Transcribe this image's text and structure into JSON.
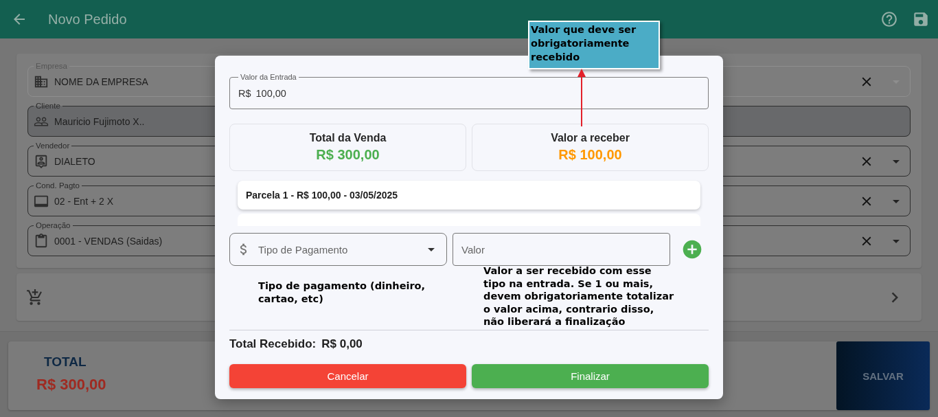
{
  "app_bar": {
    "title": "Novo Pedido"
  },
  "form": {
    "fields": [
      {
        "kind": "company",
        "label": "Empresa",
        "value": "NOME DA EMPRESA",
        "disabled": true,
        "highlighted": false,
        "clearable": true,
        "dropdown": true
      },
      {
        "kind": "client",
        "label": "Cliente",
        "value": "Mauricio Fujimoto X..",
        "disabled": false,
        "highlighted": true,
        "clearable": false,
        "dropdown": false
      },
      {
        "kind": "seller",
        "label": "Vendedor",
        "value": "DIALETO",
        "disabled": false,
        "highlighted": false,
        "clearable": true,
        "dropdown": true
      },
      {
        "kind": "payment",
        "label": "Cond. Pagto",
        "value": "02 - Ent + 2 X",
        "disabled": false,
        "highlighted": false,
        "clearable": true,
        "dropdown": true
      },
      {
        "kind": "operation",
        "label": "Operação",
        "value": "0001 - VENDAS (Saidas)",
        "disabled": false,
        "highlighted": false,
        "clearable": true,
        "dropdown": true
      }
    ]
  },
  "footer": {
    "total_label": "TOTAL",
    "total_value": "R$ 300,00",
    "save_label": "SALVAR"
  },
  "modal": {
    "entry_field": {
      "label": "Valor da Entrada",
      "prefix": "R$",
      "value": "100,00"
    },
    "summary": [
      {
        "label": "Total da Venda",
        "value": "R$ 300,00",
        "color": "#4caf50"
      },
      {
        "label": "Valor a receber",
        "value": "R$ 100,00",
        "color": "#ff9800"
      }
    ],
    "installments": [
      {
        "text": "Parcela 1 - R$ 100,00 - 03/05/2025"
      }
    ],
    "installments_overflow": true,
    "payment_type": {
      "placeholder": "Tipo de Pagamento",
      "note": "Tipo de pagamento (dinheiro, cartao, etc)"
    },
    "amount": {
      "placeholder": "Valor",
      "note": "Valor a ser recebido com esse tipo na entrada. Se 1 ou mais, devem obrigatoriamente totalizar o valor acima, contrario disso, não liberará a finalização"
    },
    "total_received": {
      "label": "Total Recebido:",
      "value": "R$ 0,00"
    },
    "buttons": [
      {
        "kind": "cancel",
        "label": "Cancelar"
      },
      {
        "kind": "confirm",
        "label": "Finalizar"
      }
    ]
  },
  "callout": {
    "text": "Valor que deve ser obrigatoriamente recebido"
  }
}
